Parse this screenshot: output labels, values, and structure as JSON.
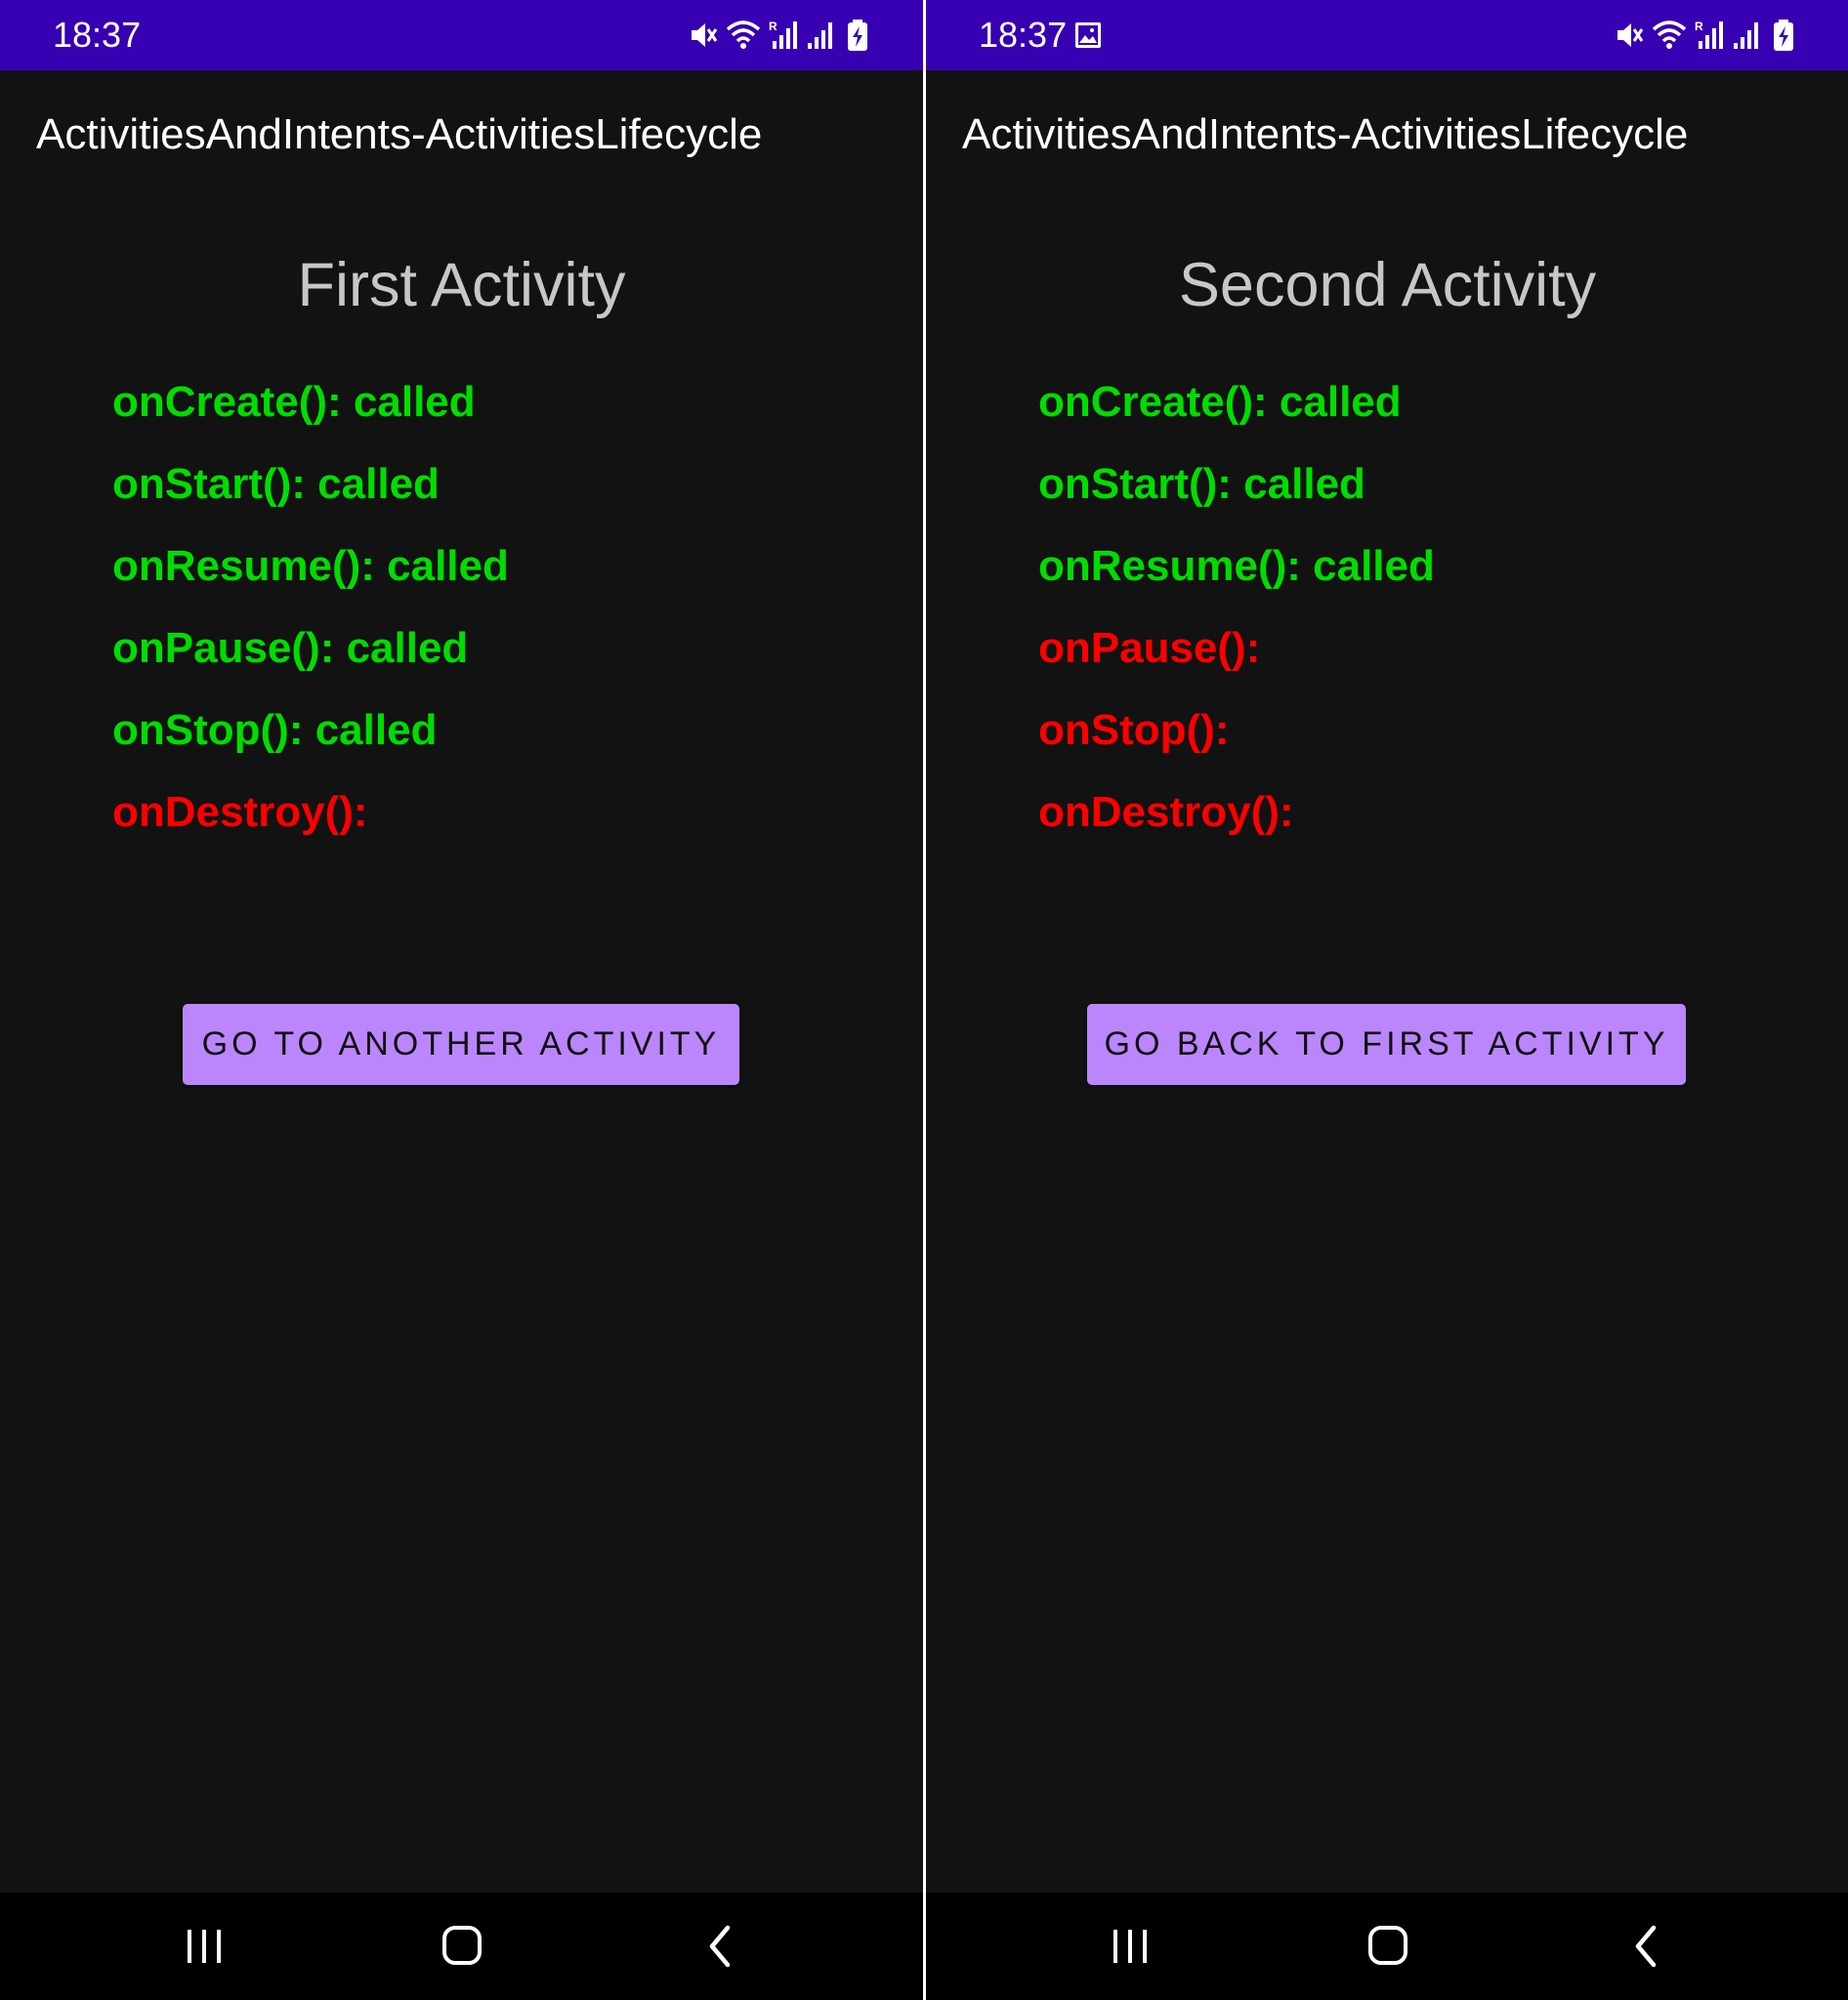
{
  "colors": {
    "status_bar": "#3700b3",
    "background": "#121212",
    "nav_bar": "#000000",
    "called": "#00dd00",
    "not_called": "#ff0000",
    "button": "#bb86fc"
  },
  "left": {
    "status_time": "18:37",
    "app_title": "ActivitiesAndIntents-ActivitiesLifecycle",
    "activity_title": "First Activity",
    "lifecycle": [
      {
        "text": "onCreate(): called",
        "state": "called"
      },
      {
        "text": "onStart(): called",
        "state": "called"
      },
      {
        "text": "onResume(): called",
        "state": "called"
      },
      {
        "text": "onPause(): called",
        "state": "called"
      },
      {
        "text": "onStop(): called",
        "state": "called"
      },
      {
        "text": "onDestroy():",
        "state": "not-called"
      }
    ],
    "button_label": "GO TO ANOTHER ACTIVITY"
  },
  "right": {
    "status_time": "18:37",
    "app_title": "ActivitiesAndIntents-ActivitiesLifecycle",
    "activity_title": "Second Activity",
    "lifecycle": [
      {
        "text": "onCreate(): called",
        "state": "called"
      },
      {
        "text": "onStart(): called",
        "state": "called"
      },
      {
        "text": "onResume(): called",
        "state": "called"
      },
      {
        "text": "onPause():",
        "state": "not-called"
      },
      {
        "text": "onStop():",
        "state": "not-called"
      },
      {
        "text": "onDestroy():",
        "state": "not-called"
      }
    ],
    "button_label": "GO BACK TO FIRST ACTIVITY"
  },
  "status_icons": [
    "mute-icon",
    "wifi-icon",
    "signal-roaming-icon",
    "signal-icon",
    "battery-charging-icon"
  ],
  "nav_icons": [
    "recents-icon",
    "home-icon",
    "back-icon"
  ]
}
